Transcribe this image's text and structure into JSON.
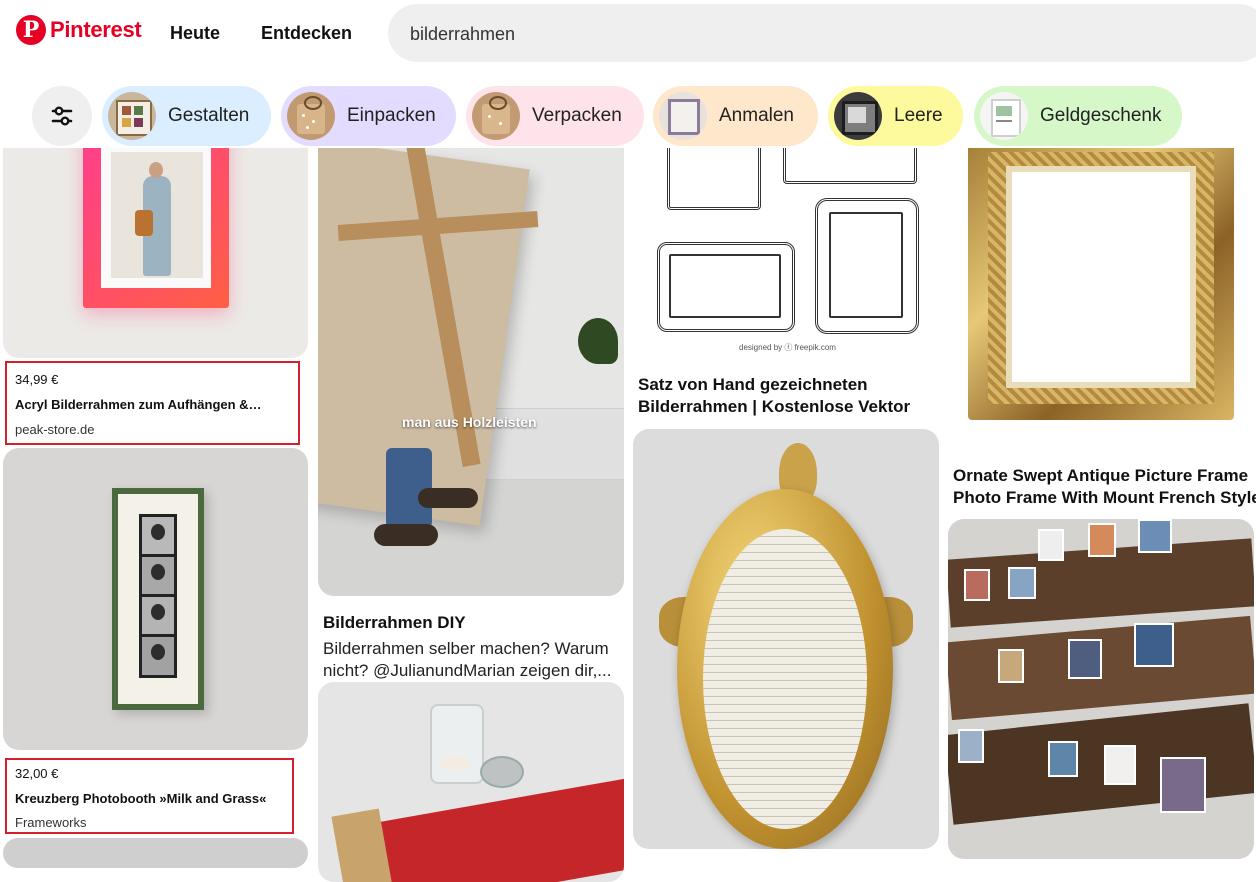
{
  "header": {
    "logo_glyph": "P",
    "logo_text": "Pinterest",
    "nav": {
      "home": "Heute",
      "explore": "Entdecken"
    },
    "search_value": "bilderrahmen"
  },
  "chips": [
    {
      "label": "Gestalten",
      "color": "#dbeeff"
    },
    {
      "label": "Einpacken",
      "color": "#e3dcff"
    },
    {
      "label": "Verpacken",
      "color": "#ffe3ea"
    },
    {
      "label": "Anmalen",
      "color": "#ffe7cc"
    },
    {
      "label": "Leere",
      "color": "#fcfa9c"
    },
    {
      "label": "Geldgeschenk",
      "color": "#d6f8c8"
    }
  ],
  "pins": {
    "acryl": {
      "price": "34,99 €",
      "title": "Acryl Bilderrahmen zum Aufhängen &…",
      "domain": "peak-store.de"
    },
    "kreuzberg": {
      "price": "32,00 €",
      "title": "Kreuzberg Photobooth »Milk and Grass«",
      "domain": "Frameworks"
    },
    "diy": {
      "overlay": "man aus Holzleisten",
      "title": "Bilderrahmen DIY",
      "desc_line1": "Bilderrahmen selber machen? Warum",
      "desc_line2": "nicht? @JulianundMarian zeigen dir,..."
    },
    "vektor": {
      "title_line1": "Satz von Hand gezeichneten",
      "title_line2": "Bilderrahmen | Kostenlose Vektor",
      "watermark": "designed by ⓕ freepik.com"
    },
    "ornate": {
      "title_line1": "Ornate Swept Antique Picture Frame",
      "title_line2": "Photo Frame With Mount French Style"
    }
  },
  "colors": {
    "brand": "#e60023",
    "highlight_box": "#d3202e"
  }
}
